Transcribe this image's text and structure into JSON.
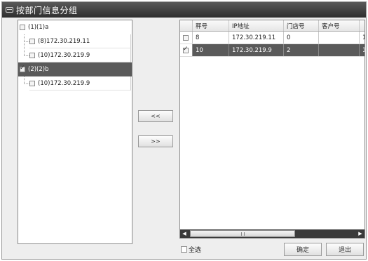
{
  "window": {
    "title": "按部门信息分组"
  },
  "tree": {
    "items": [
      {
        "label": "(1)(1)a",
        "level": 0,
        "checked": false,
        "selected": false
      },
      {
        "label": "(8)172.30.219.11",
        "level": 1,
        "checked": false,
        "selected": false
      },
      {
        "label": "(10)172.30.219.9",
        "level": 1,
        "checked": false,
        "selected": false
      },
      {
        "label": "(2)(2)b",
        "level": 0,
        "checked": true,
        "selected": true
      },
      {
        "label": "(10)172.30.219.9",
        "level": 1,
        "checked": false,
        "selected": false
      }
    ]
  },
  "buttons": {
    "move_left": "<<",
    "move_right": ">>",
    "confirm": "确定",
    "exit": "退出"
  },
  "grid": {
    "columns": [
      "秤号",
      "IP地址",
      "门店号",
      "客户号",
      ""
    ],
    "rows": [
      {
        "checked": false,
        "selected": false,
        "cells": [
          "8",
          "172.30.219.11",
          "0",
          "",
          "1"
        ]
      },
      {
        "checked": true,
        "selected": true,
        "cells": [
          "10",
          "172.30.219.9",
          "2",
          "",
          "1"
        ]
      }
    ]
  },
  "select_all": {
    "label": "全选",
    "checked": false
  }
}
